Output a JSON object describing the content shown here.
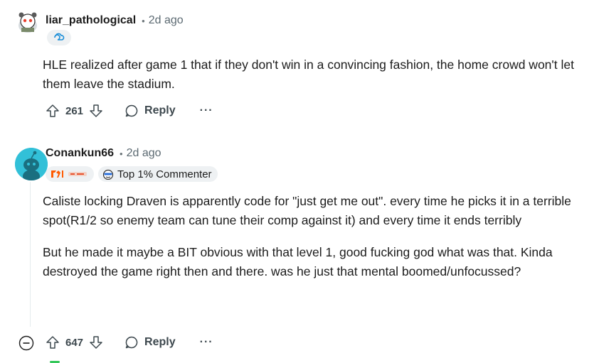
{
  "comments": [
    {
      "author": "liar_pathological",
      "time": "2d ago",
      "flair_icon": "team-flair-icon",
      "paragraphs": [
        "HLE realized after game 1 that if they don't win in a convincing fashion, the home crowd won't let them leave the stadium."
      ],
      "votes": "261",
      "reply_label": "Reply",
      "more_label": "···"
    },
    {
      "author": "Conankun66",
      "time": "2d ago",
      "flair_icon": "fnatic-team-flair-icon",
      "badge": "Top 1% Commenter",
      "paragraphs": [
        "Caliste locking Draven is apparently code for \"just get me out\". every time he picks it in a terrible spot(R1/2 so enemy team can tune their comp against it) and every time it ends terribly",
        "But he made it maybe a BIT obvious with that level 1, good fucking god what was that. Kinda destroyed the game right then and there. was he just that mental boomed/unfocussed?"
      ],
      "votes": "647",
      "reply_label": "Reply",
      "more_label": "···"
    }
  ],
  "colors": {
    "text": "#1c1c1c",
    "meta": "#5c6a72",
    "avatar_bg": "#32c0d8",
    "pill_bg": "#eef1f3"
  }
}
